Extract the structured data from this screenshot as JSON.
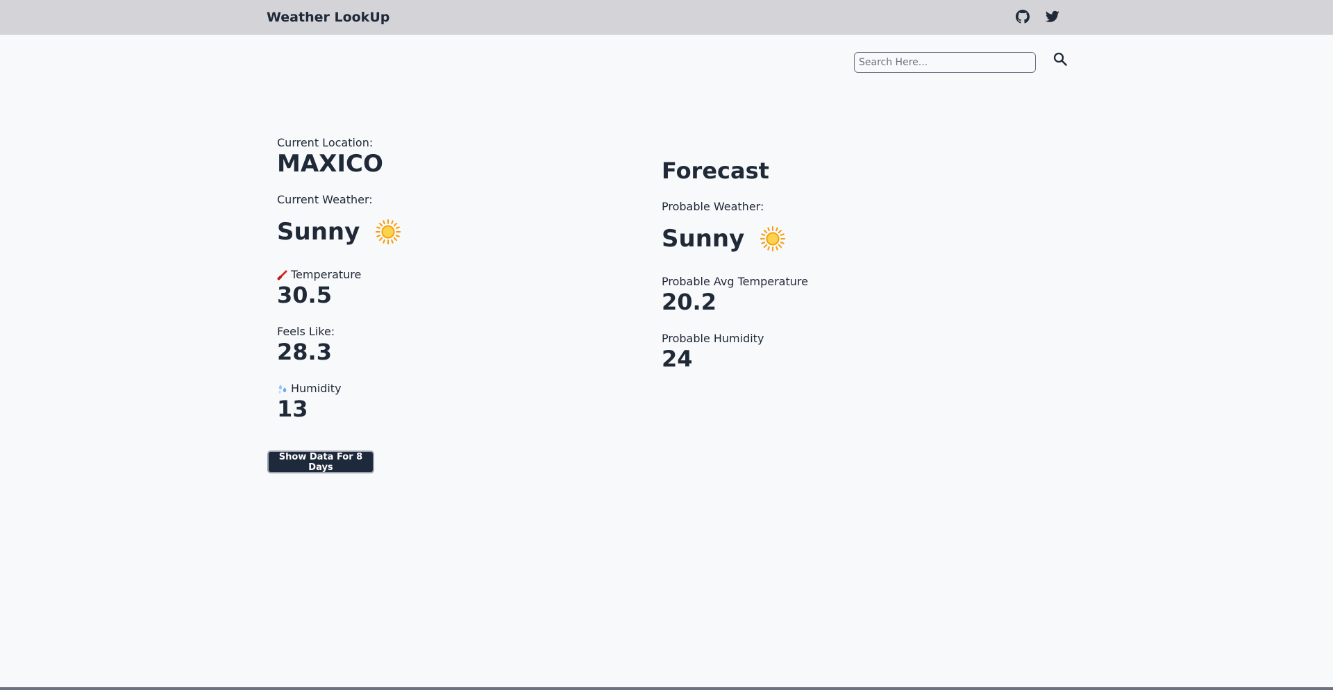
{
  "header": {
    "title": "Weather LookUp",
    "icons": [
      "github-icon",
      "twitter-icon"
    ]
  },
  "search": {
    "placeholder": "Search Here...",
    "value": ""
  },
  "current": {
    "location_label": "Current Location:",
    "location": "MAXICO",
    "weather_label": "Current Weather:",
    "weather": "Sunny",
    "weather_icon": "sun-icon",
    "temperature_label": "Temperature",
    "temperature": "30.5",
    "feels_like_label": "Feels Like:",
    "feels_like": "28.3",
    "humidity_label": "Humidity",
    "humidity": "13"
  },
  "forecast": {
    "title": "Forecast",
    "weather_label": "Probable Weather:",
    "weather": "Sunny",
    "weather_icon": "sun-icon",
    "avg_temp_label": "Probable Avg Temperature",
    "avg_temp": "20.2",
    "humidity_label": "Probable Humidity",
    "humidity": "24"
  },
  "actions": {
    "show_days_label": "Show Data For 8 Days"
  },
  "colors": {
    "navbar": "#d4d4d8",
    "background": "#f8f9fb",
    "text": "#1f2937",
    "button": "#1e293b",
    "sun": "#fbbf24"
  }
}
